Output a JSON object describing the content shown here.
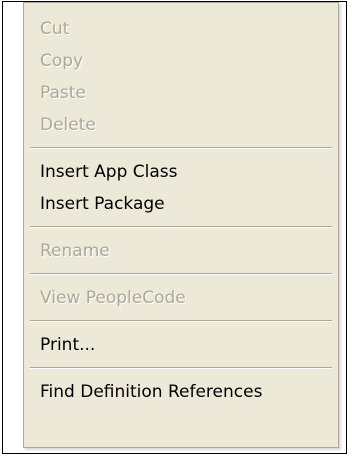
{
  "menu": {
    "items": [
      {
        "label": "Cut",
        "enabled": false
      },
      {
        "label": "Copy",
        "enabled": false
      },
      {
        "label": "Paste",
        "enabled": false
      },
      {
        "label": "Delete",
        "enabled": false
      },
      {
        "label": "Insert App Class",
        "enabled": true
      },
      {
        "label": "Insert Package",
        "enabled": true
      },
      {
        "label": "Rename",
        "enabled": false
      },
      {
        "label": "View PeopleCode",
        "enabled": false
      },
      {
        "label": "Print...",
        "enabled": true
      },
      {
        "label": "Find Definition References",
        "enabled": true
      }
    ]
  },
  "colors": {
    "menu_bg": "#ece9d8",
    "disabled_text": "#aca899",
    "enabled_text": "#000000",
    "border": "#000000"
  }
}
